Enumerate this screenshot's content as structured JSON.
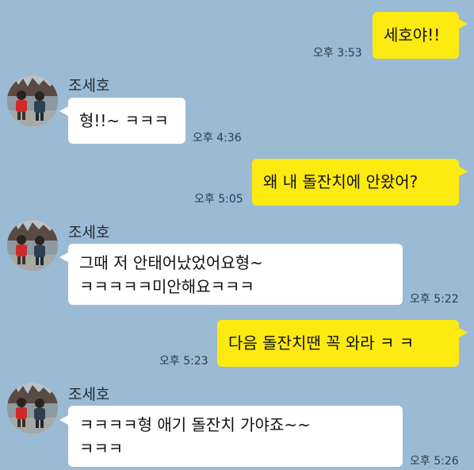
{
  "contact": {
    "name": "조세호",
    "avatar_icon": "profile-photo-two-children-icon"
  },
  "colors": {
    "background": "#9bbbd4",
    "outgoing_bubble": "#fdea11",
    "incoming_bubble": "#ffffff"
  },
  "messages": [
    {
      "direction": "out",
      "lines": [
        "세호야!!"
      ],
      "time": "오후 3:53"
    },
    {
      "direction": "in",
      "sender": "조세호",
      "lines": [
        "형!!~ ㅋㅋㅋ"
      ],
      "time": "오후 4:36"
    },
    {
      "direction": "out",
      "lines": [
        "왜 내 돌잔치에 안왔어?"
      ],
      "time": "오후 5:05"
    },
    {
      "direction": "in",
      "sender": "조세호",
      "lines": [
        "그때 저 안태어났었어요형~",
        "ㅋㅋㅋㅋㅋ미안해요ㅋㅋㅋ"
      ],
      "time": "오후 5:22"
    },
    {
      "direction": "out",
      "lines": [
        "다음 돌잔치땐 꼭 와라 ㅋ ㅋ"
      ],
      "time": "오후 5:23"
    },
    {
      "direction": "in",
      "sender": "조세호",
      "lines": [
        "ㅋㅋㅋㅋ형 애기 돌잔치 가야죠~~",
        "ㅋㅋㅋ"
      ],
      "time": "오후 5:26"
    }
  ]
}
